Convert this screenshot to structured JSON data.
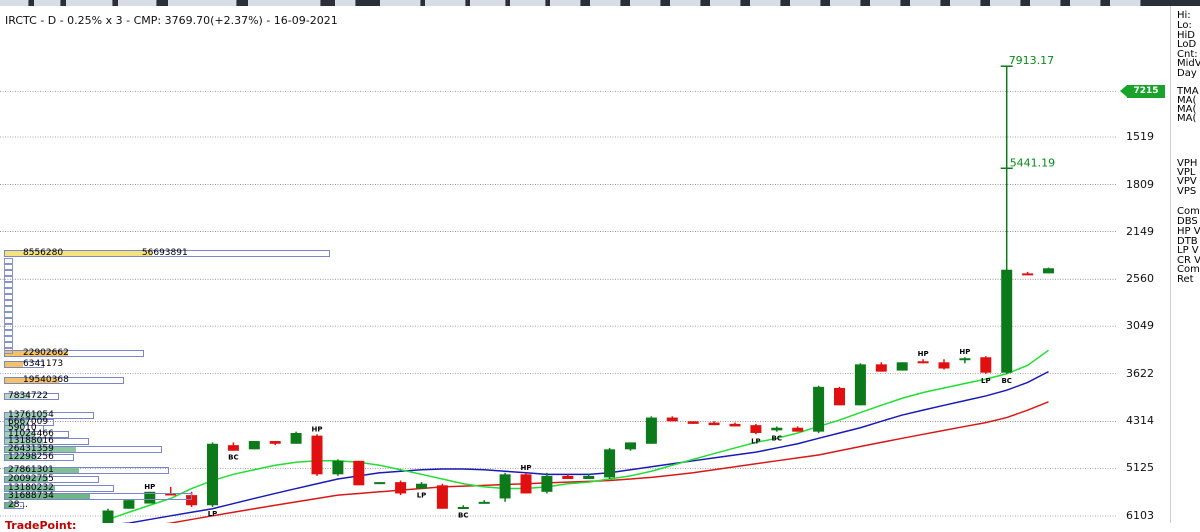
{
  "title": "IRCTC - D - 0.25% x 3 - CMP: 3769.70(+2.37%) - 16-09-2021",
  "y_axis_labels": [
    "6103",
    "5125",
    "4314",
    "3622",
    "3049",
    "2560",
    "2149",
    "1809",
    "1519"
  ],
  "current_price_tag": "7215",
  "annotations": {
    "high_price": "7913.17",
    "mid_price": "5441.19"
  },
  "trade_point": "TradePoint:",
  "right_panel_labels": [
    "Hi:",
    "Lo:",
    "HiD",
    "LoD",
    "Cnt:",
    "MidV",
    "Day",
    "TMA",
    "MA(",
    "MA(",
    "MA(",
    "VPH",
    "VPL",
    "VPV",
    "VPS",
    "Com",
    "DBS",
    "HP V",
    "DTB",
    "LP V",
    "CR V",
    "Com",
    "Ret"
  ],
  "volume_profile": [
    {
      "left_label": "8556280",
      "right_label": "56693891",
      "color": "#f5e27a"
    },
    {
      "left_label": "22902662",
      "right_label": "",
      "color": "#f2c266"
    },
    {
      "left_label": "6341173",
      "right_label": "",
      "color": "#f2c266"
    },
    {
      "left_label": "19540368",
      "right_label": "",
      "color": "#f2c266"
    },
    {
      "left_label": "7834722",
      "right_label": "",
      "color": "#b8d9c6"
    },
    {
      "left_label": "13761054",
      "right_label": "",
      "color": "#9fd0b4"
    },
    {
      "left_label": "6667009",
      "right_label": "",
      "color": "#9fd0b4"
    },
    {
      "left_label": "59010",
      "right_label": "",
      "color": "#9fd0b4"
    },
    {
      "left_label": "11024466",
      "right_label": "",
      "color": "#9fd0b4"
    },
    {
      "left_label": "13188016",
      "right_label": "",
      "color": "#9fd0b4"
    },
    {
      "left_label": "26431359",
      "right_label": "",
      "color": "#8cc7a2"
    },
    {
      "left_label": "12298256",
      "right_label": "",
      "color": "#8cc7a2"
    },
    {
      "left_label": "27861301",
      "right_label": "",
      "color": "#7fbf96"
    },
    {
      "left_label": "20092755",
      "right_label": "",
      "color": "#7fbf96"
    },
    {
      "left_label": "13180232",
      "right_label": "",
      "color": "#7fbf96"
    },
    {
      "left_label": "31688734",
      "right_label": "",
      "color": "#6fb685"
    },
    {
      "left_label": "28...",
      "right_label": "",
      "color": "#6fb685"
    }
  ],
  "chart_data": {
    "type": "candlestick",
    "scale": "log",
    "ylim": [
      1490,
      9000
    ],
    "y_ticks": [
      1519,
      1809,
      2149,
      2560,
      3049,
      3622,
      4314,
      5125,
      6103
    ],
    "colors": {
      "up": "#0c7a1a",
      "down": "#e01010",
      "ma_green": "#22dd33",
      "ma_blue": "#1a1ab8",
      "ma_red": "#d81818"
    },
    "candles": [
      {
        "open": 1440,
        "high": 1560,
        "low": 1420,
        "close": 1550,
        "up": true
      },
      {
        "open": 1560,
        "high": 1610,
        "low": 1560,
        "close": 1610,
        "up": true
      },
      {
        "open": 1590,
        "high": 1660,
        "low": 1590,
        "close": 1660,
        "up": true
      },
      {
        "open": 1650,
        "high": 1690,
        "low": 1640,
        "close": 1640,
        "up": false
      },
      {
        "open": 1640,
        "high": 1660,
        "low": 1570,
        "close": 1580,
        "up": false
      },
      {
        "open": 1580,
        "high": 1990,
        "low": 1570,
        "close": 1980,
        "up": true
      },
      {
        "open": 1970,
        "high": 1990,
        "low": 1930,
        "close": 1930,
        "up": false
      },
      {
        "open": 1940,
        "high": 2000,
        "low": 1940,
        "close": 2000,
        "up": true
      },
      {
        "open": 2000,
        "high": 2000,
        "low": 1970,
        "close": 1980,
        "up": false
      },
      {
        "open": 1980,
        "high": 2070,
        "low": 1980,
        "close": 2060,
        "up": true
      },
      {
        "open": 2040,
        "high": 2050,
        "low": 1760,
        "close": 1770,
        "up": false
      },
      {
        "open": 1770,
        "high": 1870,
        "low": 1760,
        "close": 1860,
        "up": true
      },
      {
        "open": 1860,
        "high": 1860,
        "low": 1700,
        "close": 1700,
        "up": false
      },
      {
        "open": 1710,
        "high": 1720,
        "low": 1710,
        "close": 1720,
        "up": true
      },
      {
        "open": 1720,
        "high": 1730,
        "low": 1640,
        "close": 1650,
        "up": false
      },
      {
        "open": 1680,
        "high": 1720,
        "low": 1680,
        "close": 1710,
        "up": true
      },
      {
        "open": 1700,
        "high": 1710,
        "low": 1560,
        "close": 1560,
        "up": false
      },
      {
        "open": 1560,
        "high": 1580,
        "low": 1560,
        "close": 1570,
        "up": true
      },
      {
        "open": 1590,
        "high": 1610,
        "low": 1590,
        "close": 1600,
        "up": true
      },
      {
        "open": 1620,
        "high": 1780,
        "low": 1600,
        "close": 1770,
        "up": true
      },
      {
        "open": 1770,
        "high": 1780,
        "low": 1650,
        "close": 1650,
        "up": false
      },
      {
        "open": 1660,
        "high": 1780,
        "low": 1650,
        "close": 1760,
        "up": true
      },
      {
        "open": 1760,
        "high": 1770,
        "low": 1740,
        "close": 1740,
        "up": false
      },
      {
        "open": 1740,
        "high": 1770,
        "low": 1740,
        "close": 1760,
        "up": true
      },
      {
        "open": 1750,
        "high": 1950,
        "low": 1740,
        "close": 1940,
        "up": true
      },
      {
        "open": 1940,
        "high": 1990,
        "low": 1930,
        "close": 1990,
        "up": true
      },
      {
        "open": 1980,
        "high": 2190,
        "low": 1980,
        "close": 2180,
        "up": true
      },
      {
        "open": 2180,
        "high": 2190,
        "low": 2150,
        "close": 2150,
        "up": false
      },
      {
        "open": 2150,
        "high": 2150,
        "low": 2130,
        "close": 2130,
        "up": false
      },
      {
        "open": 2140,
        "high": 2150,
        "low": 2120,
        "close": 2120,
        "up": false
      },
      {
        "open": 2130,
        "high": 2140,
        "low": 2110,
        "close": 2110,
        "up": false
      },
      {
        "open": 2120,
        "high": 2130,
        "low": 2050,
        "close": 2060,
        "up": false
      },
      {
        "open": 2080,
        "high": 2110,
        "low": 2070,
        "close": 2100,
        "up": true
      },
      {
        "open": 2100,
        "high": 2110,
        "low": 2070,
        "close": 2070,
        "up": false
      },
      {
        "open": 2070,
        "high": 2450,
        "low": 2060,
        "close": 2440,
        "up": true
      },
      {
        "open": 2430,
        "high": 2440,
        "low": 2280,
        "close": 2280,
        "up": false
      },
      {
        "open": 2280,
        "high": 2660,
        "low": 2280,
        "close": 2650,
        "up": true
      },
      {
        "open": 2650,
        "high": 2670,
        "low": 2580,
        "close": 2580,
        "up": false
      },
      {
        "open": 2590,
        "high": 2670,
        "low": 2590,
        "close": 2670,
        "up": true
      },
      {
        "open": 2680,
        "high": 2700,
        "low": 2660,
        "close": 2660,
        "up": false
      },
      {
        "open": 2670,
        "high": 2700,
        "low": 2600,
        "close": 2610,
        "up": false
      },
      {
        "open": 2700,
        "high": 2720,
        "low": 2660,
        "close": 2710,
        "up": true
      },
      {
        "open": 2720,
        "high": 2730,
        "low": 2560,
        "close": 2570,
        "up": false
      },
      {
        "open": 2570,
        "high": 7913.17,
        "low": 2560,
        "close": 3750,
        "up": true
      },
      {
        "open": 3700,
        "high": 3720,
        "low": 3680,
        "close": 3690,
        "up": false
      },
      {
        "open": 3700,
        "high": 3780,
        "low": 3700,
        "close": 3769.7,
        "up": true
      }
    ],
    "markers": [
      {
        "candle": 2,
        "label": "HP",
        "pos": "above"
      },
      {
        "candle": 5,
        "label": "LP",
        "pos": "below"
      },
      {
        "candle": 6,
        "label": "BC",
        "pos": "below"
      },
      {
        "candle": 10,
        "label": "HP",
        "pos": "above"
      },
      {
        "candle": 15,
        "label": "LP",
        "pos": "below"
      },
      {
        "candle": 17,
        "label": "BC",
        "pos": "below"
      },
      {
        "candle": 20,
        "label": "HP",
        "pos": "above"
      },
      {
        "candle": 31,
        "label": "LP",
        "pos": "below"
      },
      {
        "candle": 32,
        "label": "BC",
        "pos": "below"
      },
      {
        "candle": 39,
        "label": "HP",
        "pos": "above"
      },
      {
        "candle": 41,
        "label": "HP",
        "pos": "above"
      },
      {
        "candle": 42,
        "label": "LP",
        "pos": "below"
      },
      {
        "candle": 43,
        "label": "BC",
        "pos": "below"
      }
    ],
    "ma_green": [
      1500,
      1540,
      1580,
      1620,
      1680,
      1730,
      1770,
      1800,
      1830,
      1850,
      1860,
      1860,
      1850,
      1830,
      1800,
      1770,
      1740,
      1710,
      1690,
      1680,
      1680,
      1690,
      1710,
      1720,
      1740,
      1760,
      1790,
      1830,
      1870,
      1910,
      1950,
      1990,
      2020,
      2060,
      2110,
      2160,
      2220,
      2280,
      2340,
      2390,
      2430,
      2470,
      2510,
      2560,
      2640,
      2790
    ],
    "ma_blue": [
      1470,
      1480,
      1500,
      1520,
      1540,
      1560,
      1590,
      1620,
      1650,
      1680,
      1710,
      1740,
      1760,
      1780,
      1790,
      1800,
      1805,
      1805,
      1800,
      1790,
      1780,
      1770,
      1770,
      1770,
      1780,
      1800,
      1820,
      1840,
      1860,
      1880,
      1900,
      1920,
      1950,
      1980,
      2020,
      2060,
      2100,
      2150,
      2200,
      2240,
      2280,
      2320,
      2360,
      2410,
      2480,
      2580
    ],
    "ma_red": [
      1440,
      1450,
      1465,
      1480,
      1500,
      1520,
      1540,
      1560,
      1580,
      1600,
      1620,
      1640,
      1650,
      1660,
      1670,
      1680,
      1690,
      1695,
      1700,
      1705,
      1710,
      1715,
      1720,
      1725,
      1730,
      1740,
      1750,
      1765,
      1780,
      1800,
      1820,
      1840,
      1860,
      1880,
      1900,
      1930,
      1960,
      1990,
      2020,
      2050,
      2080,
      2110,
      2140,
      2180,
      2240,
      2310
    ]
  }
}
